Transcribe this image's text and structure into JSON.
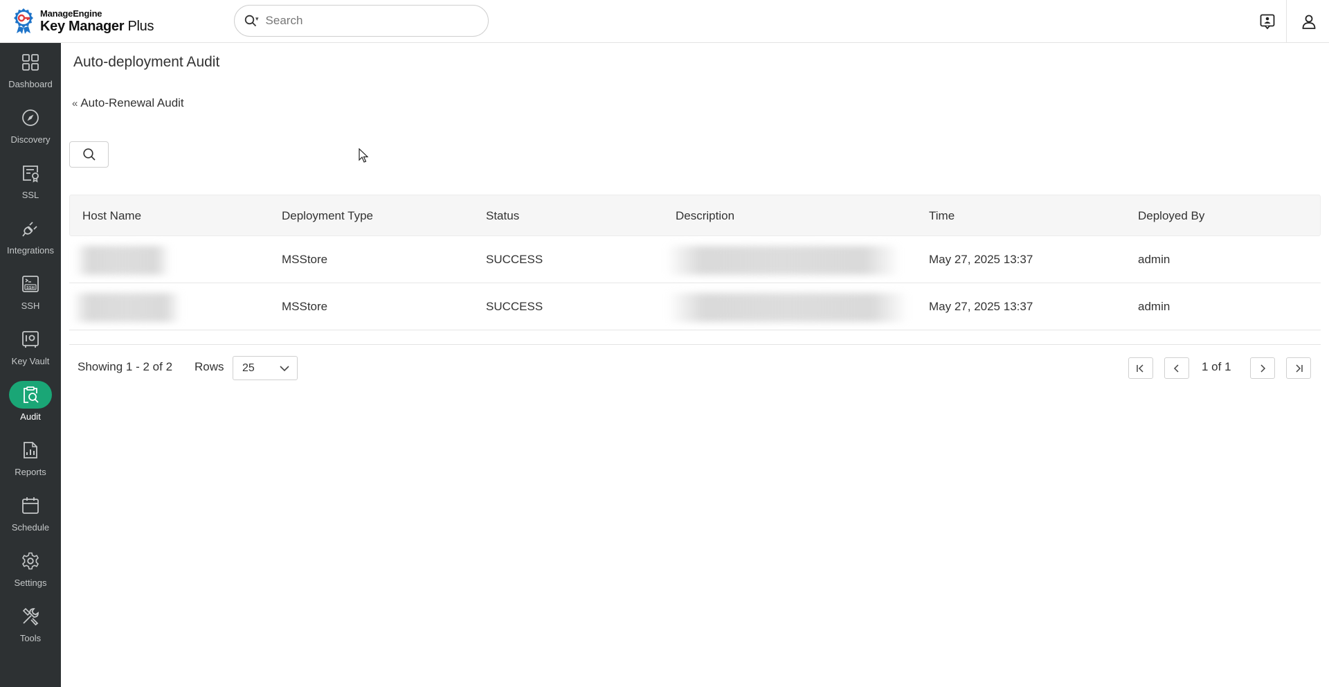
{
  "header": {
    "vendor": "ManageEngine",
    "product_main": "Key Manager",
    "product_suffix": " Plus",
    "search_placeholder": "Search"
  },
  "sidebar": {
    "items": [
      {
        "label": "Dashboard",
        "icon": "dashboard-icon"
      },
      {
        "label": "Discovery",
        "icon": "compass-icon"
      },
      {
        "label": "SSL",
        "icon": "certificate-icon"
      },
      {
        "label": "Integrations",
        "icon": "plug-icon"
      },
      {
        "label": "SSH",
        "icon": "ssh-terminal-icon"
      },
      {
        "label": "Key Vault",
        "icon": "vault-icon"
      },
      {
        "label": "Audit",
        "icon": "audit-icon",
        "active": true
      },
      {
        "label": "Reports",
        "icon": "reports-icon"
      },
      {
        "label": "Schedule",
        "icon": "calendar-icon"
      },
      {
        "label": "Settings",
        "icon": "gear-icon"
      },
      {
        "label": "Tools",
        "icon": "tools-icon"
      }
    ],
    "active_color": "#1aa676",
    "background": "#2d3133"
  },
  "main": {
    "title": "Auto-deployment Audit",
    "back_link": "Auto-Renewal Audit",
    "back_symbol": "«"
  },
  "table": {
    "columns": [
      "Host Name",
      "Deployment Type",
      "Status",
      "Description",
      "Time",
      "Deployed By"
    ],
    "rows": [
      {
        "host_name": "",
        "deployment_type": "MSStore",
        "status": "SUCCESS",
        "description": "",
        "time": "May 27, 2025 13:37",
        "deployed_by": "admin"
      },
      {
        "host_name": "",
        "deployment_type": "MSStore",
        "status": "SUCCESS",
        "description": "",
        "time": "May 27, 2025 13:37",
        "deployed_by": "admin"
      }
    ]
  },
  "pagination": {
    "showing": "Showing 1 - 2 of 2",
    "rows_label": "Rows",
    "rows_value": "25",
    "page_text": "1 of 1"
  }
}
